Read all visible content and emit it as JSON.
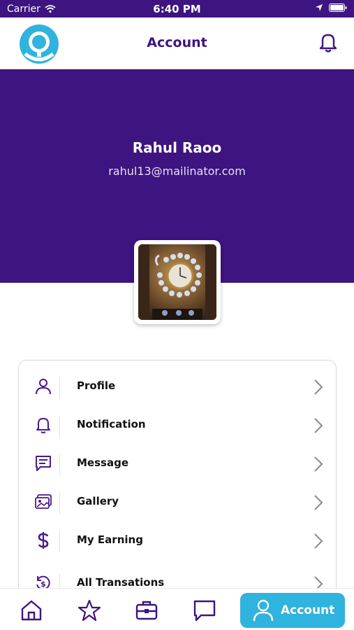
{
  "status_bar": {
    "carrier": "Carrier",
    "time": "6:40 PM"
  },
  "header": {
    "title": "Account",
    "logo_icon": "search-logo",
    "notification_icon": "bell-icon"
  },
  "profile": {
    "name": "Rahul Raoo",
    "email": "rahul13@mailinator.com",
    "avatar_icon": "wall-clock-photo"
  },
  "menu": {
    "items": [
      {
        "label": "Profile",
        "icon": "user-icon"
      },
      {
        "label": "Notification",
        "icon": "bell-icon"
      },
      {
        "label": "Message",
        "icon": "message-icon"
      },
      {
        "label": "Gallery",
        "icon": "gallery-icon"
      },
      {
        "label": "My Earning",
        "icon": "dollar-icon"
      },
      {
        "label": "All Transations",
        "icon": "transactions-icon"
      }
    ]
  },
  "bottom_nav": {
    "items": [
      {
        "icon": "home-icon"
      },
      {
        "icon": "star-icon"
      },
      {
        "icon": "briefcase-icon"
      },
      {
        "icon": "chat-icon"
      }
    ],
    "active": {
      "label": "Account",
      "icon": "user-icon"
    }
  },
  "colors": {
    "brand_purple": "#3d1480",
    "accent_blue": "#2fb3df",
    "icon_purple": "#4a1a8c"
  }
}
